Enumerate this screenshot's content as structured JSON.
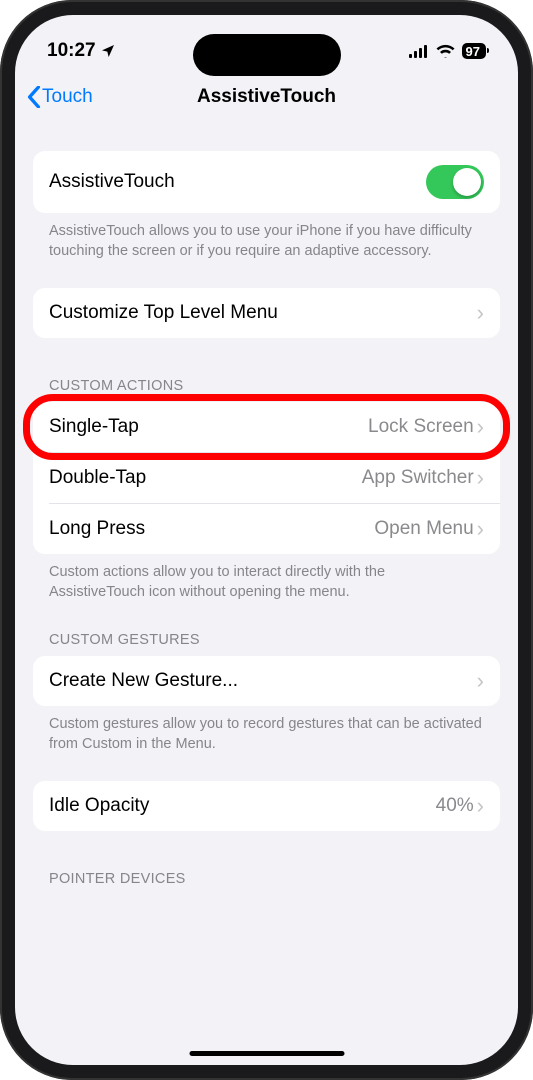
{
  "statusBar": {
    "time": "10:27",
    "battery": "97"
  },
  "nav": {
    "back": "Touch",
    "title": "AssistiveTouch"
  },
  "mainToggle": {
    "label": "AssistiveTouch",
    "footer": "AssistiveTouch allows you to use your iPhone if you have difficulty touching the screen or if you require an adaptive accessory."
  },
  "customizeMenu": {
    "label": "Customize Top Level Menu"
  },
  "customActions": {
    "header": "CUSTOM ACTIONS",
    "items": [
      {
        "label": "Single-Tap",
        "value": "Lock Screen"
      },
      {
        "label": "Double-Tap",
        "value": "App Switcher"
      },
      {
        "label": "Long Press",
        "value": "Open Menu"
      }
    ],
    "footer": "Custom actions allow you to interact directly with the AssistiveTouch icon without opening the menu."
  },
  "customGestures": {
    "header": "CUSTOM GESTURES",
    "label": "Create New Gesture...",
    "footer": "Custom gestures allow you to record gestures that can be activated from Custom in the Menu."
  },
  "idleOpacity": {
    "label": "Idle Opacity",
    "value": "40%"
  },
  "pointerDevices": {
    "header": "POINTER DEVICES"
  }
}
